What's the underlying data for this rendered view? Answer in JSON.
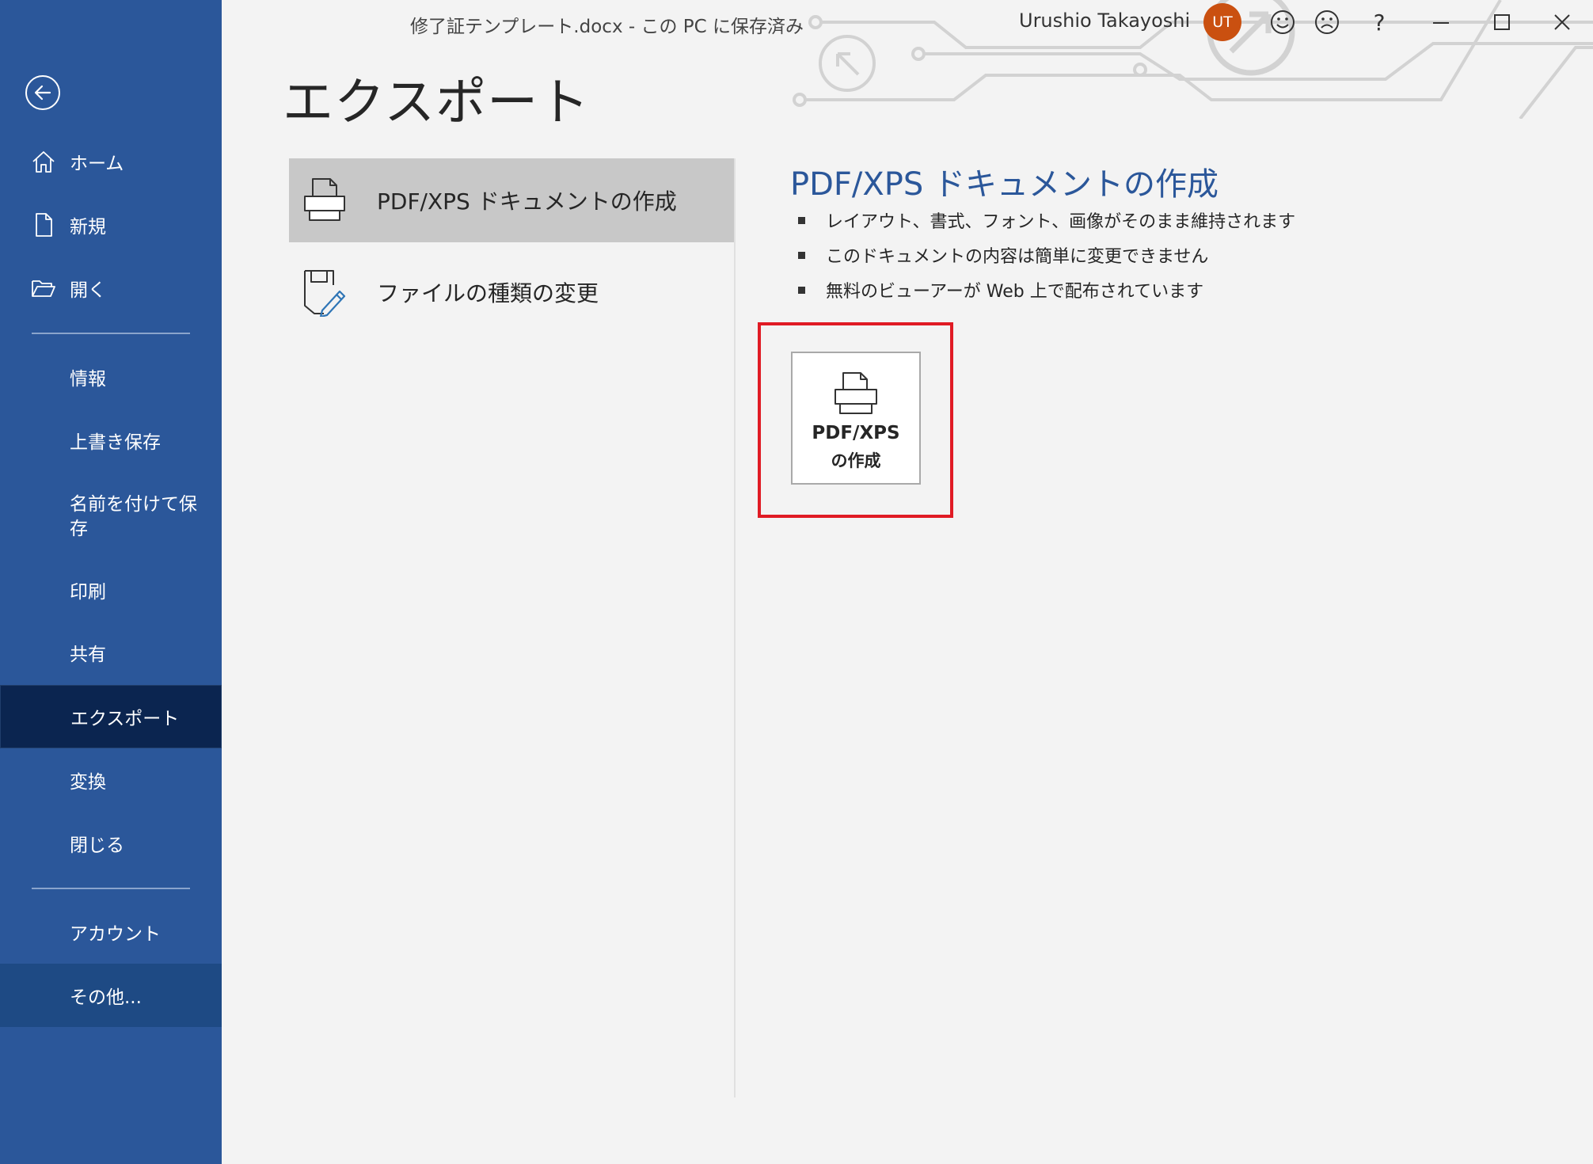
{
  "titlebar": {
    "document_title": "修了証テンプレート.docx  -  この PC に保存済み",
    "user_name": "Urushio Takayoshi",
    "avatar_initials": "UT",
    "help_label": "?",
    "icons": [
      "smiley-icon",
      "frown-icon",
      "help-icon",
      "minimize-icon",
      "maximize-icon",
      "close-icon"
    ]
  },
  "sidebar": {
    "back_icon": "back-arrow-icon",
    "items": [
      {
        "label": "ホーム",
        "icon": "home-icon"
      },
      {
        "label": "新規",
        "icon": "new-document-icon"
      },
      {
        "label": "開く",
        "icon": "folder-open-icon"
      },
      {
        "label": "情報"
      },
      {
        "label": "上書き保存"
      },
      {
        "label": "名前を付けて保存"
      },
      {
        "label": "印刷"
      },
      {
        "label": "共有"
      },
      {
        "label": "エクスポート",
        "active": true
      },
      {
        "label": "変換"
      },
      {
        "label": "閉じる"
      },
      {
        "label": "アカウント"
      },
      {
        "label": "その他..."
      }
    ]
  },
  "main": {
    "page_title": "エクスポート",
    "options": [
      {
        "label": "PDF/XPS ドキュメントの作成",
        "icon": "pdf-document-icon",
        "selected": true
      },
      {
        "label": "ファイルの種類の変更",
        "icon": "change-file-type-icon"
      }
    ]
  },
  "detail": {
    "heading": "PDF/XPS ドキュメントの作成",
    "bullets": [
      "レイアウト、書式、フォント、画像がそのまま維持されます",
      "このドキュメントの内容は簡単に変更できません",
      "無料のビューアーが Web 上で配布されています"
    ],
    "button_line1": "PDF/XPS",
    "button_line2": "の作成"
  },
  "colors": {
    "sidebar_bg": "#2b579a",
    "sidebar_active": "#0b2550",
    "sidebar_more": "#1e4a84",
    "accent_heading": "#2b579a",
    "highlight": "#e01b24",
    "avatar_bg": "#ca5010",
    "selected_option_bg": "#c8c8c8"
  }
}
